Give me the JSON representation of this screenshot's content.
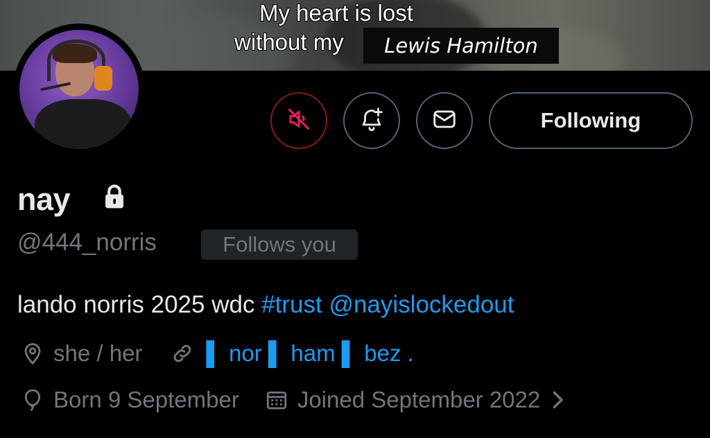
{
  "banner": {
    "meme_line_1": "My heart is lost",
    "meme_line_2": "without my",
    "name_tag": "Lewis Hamilton"
  },
  "actions": {
    "mute_icon": "speaker-muted-icon",
    "notify_icon": "bell-plus-icon",
    "message_icon": "envelope-icon",
    "following_label": "Following",
    "mute_color": "#e0245e"
  },
  "profile": {
    "display_name": "nay",
    "protected_icon": "lock-icon",
    "handle": "@444_norris",
    "follows_you": "Follows you",
    "bio_text": "lando norris 2025 wdc ",
    "bio_hashtag": "#trust",
    "bio_mention": "@nayislockedout",
    "pronouns": "she / her",
    "website": "▌ nor ▌ ham ▌ bez .",
    "birthday": "Born 9 September",
    "joined": "Joined September 2022"
  },
  "colors": {
    "accent": "#1d9bf0",
    "muted_text": "#71767b",
    "primary_text": "#e7e9ea"
  }
}
